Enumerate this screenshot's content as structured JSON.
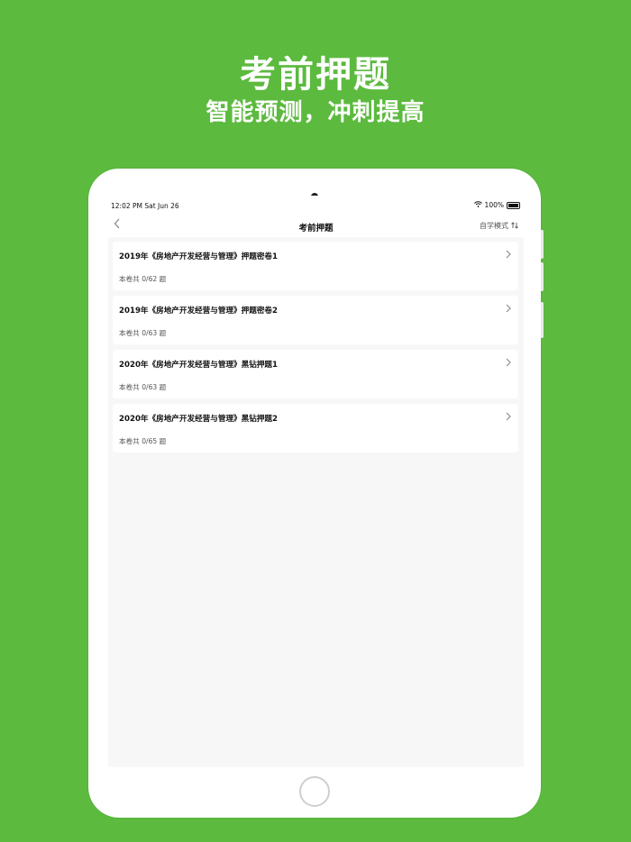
{
  "promo": {
    "title": "考前押题",
    "subtitle": "智能预测，冲刺提高"
  },
  "status_bar": {
    "time": "12:02 PM   Sat Jun 26",
    "battery": "100%"
  },
  "navbar": {
    "back_icon": "chevron-left-icon",
    "title": "考前押题",
    "mode_label": "自学模式",
    "mode_icon": "swap-icon"
  },
  "papers": [
    {
      "title": "2019年《房地产开发经营与管理》押题密卷1",
      "count": "本卷共 0/62 题"
    },
    {
      "title": "2019年《房地产开发经营与管理》押题密卷2",
      "count": "本卷共 0/63 题"
    },
    {
      "title": "2020年《房地产开发经营与管理》黑钻押题1",
      "count": "本卷共 0/63 题"
    },
    {
      "title": "2020年《房地产开发经营与管理》黑钻押题2",
      "count": "本卷共 0/65 题"
    }
  ],
  "colors": {
    "background": "#5cba3f",
    "screen": "#f7f7f7",
    "card": "#ffffff"
  }
}
